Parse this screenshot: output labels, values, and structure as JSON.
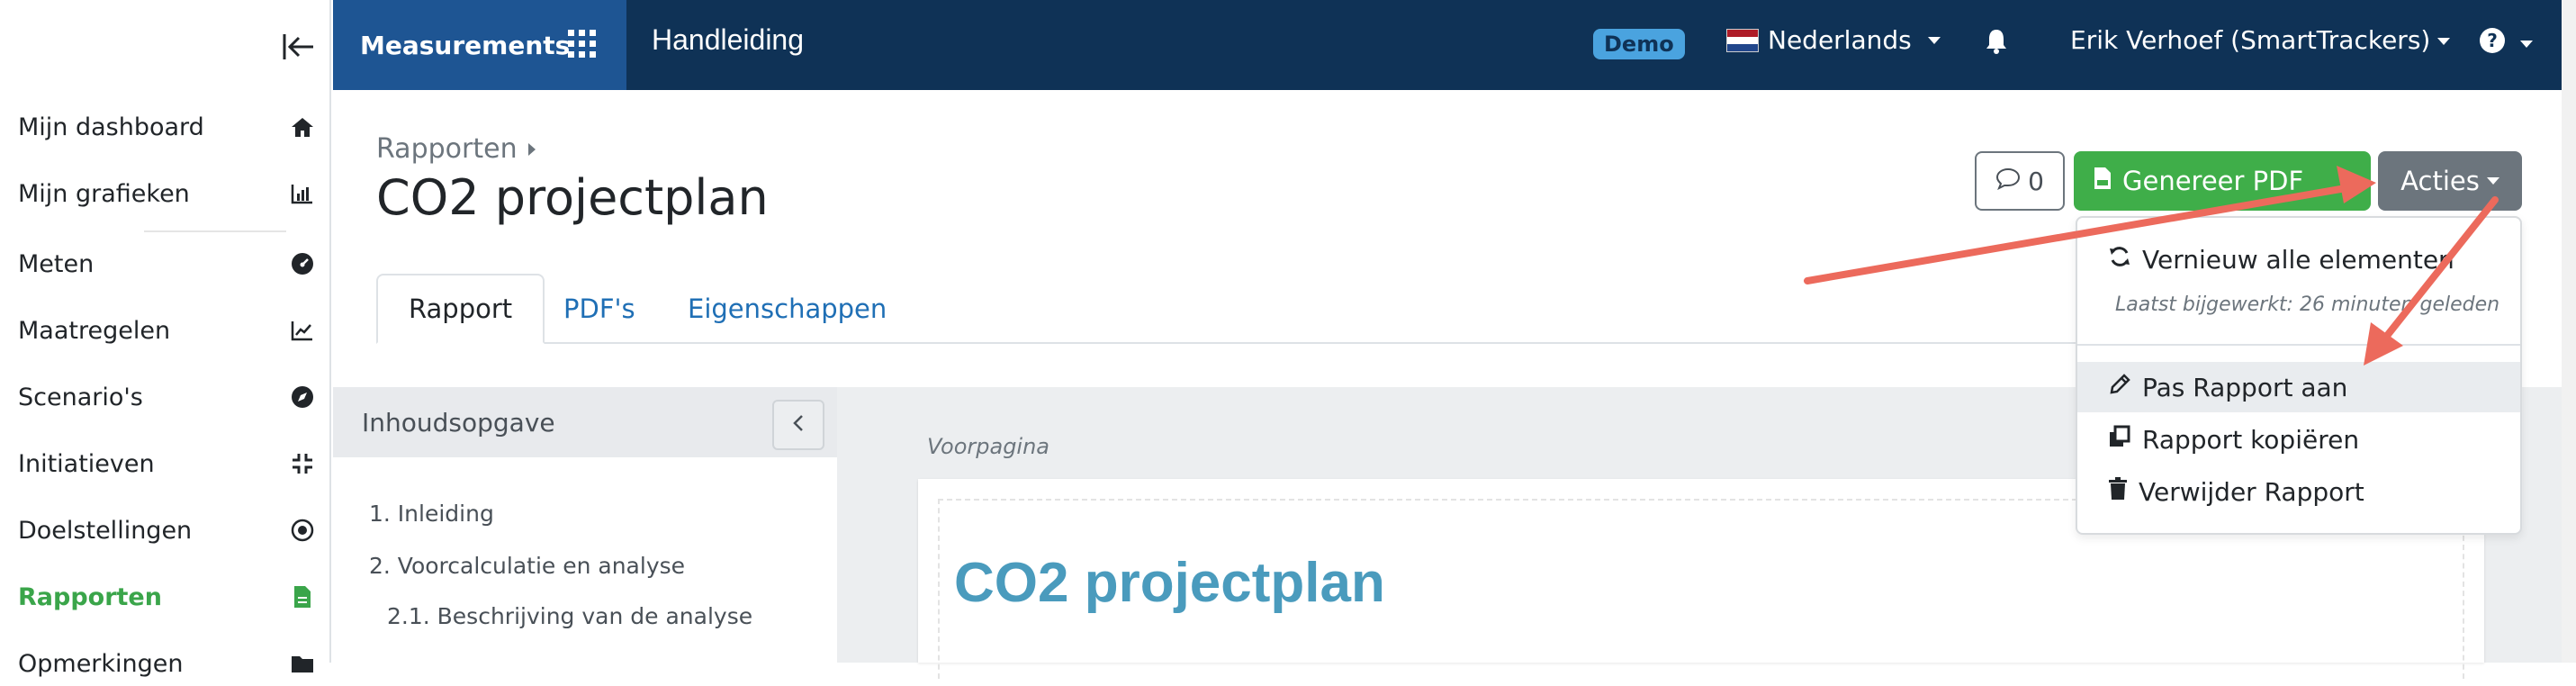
{
  "sidebar": {
    "items": [
      {
        "label": "Mijn dashboard",
        "icon": "home-icon"
      },
      {
        "label": "Mijn grafieken",
        "icon": "bar-chart-icon"
      },
      {
        "label": "Meten",
        "icon": "gauge-icon"
      },
      {
        "label": "Maatregelen",
        "icon": "line-chart-icon"
      },
      {
        "label": "Scenario's",
        "icon": "compass-icon"
      },
      {
        "label": "Initiatieven",
        "icon": "compress-icon"
      },
      {
        "label": "Doelstellingen",
        "icon": "target-icon"
      },
      {
        "label": "Rapporten",
        "icon": "file-icon",
        "active": true
      },
      {
        "label": "Opmerkingen",
        "icon": "folder-icon"
      }
    ]
  },
  "topbar": {
    "brand": "Measurements",
    "handleiding": "Handleiding",
    "demo": "Demo",
    "language": "Nederlands",
    "user": "Erik Verhoef (SmartTrackers)",
    "help": "?"
  },
  "header": {
    "breadcrumb": "Rapporten",
    "title": "CO2 projectplan",
    "comments_count": "0",
    "pdf_button": "Genereer PDF",
    "acties_button": "Acties"
  },
  "tabs": [
    {
      "label": "Rapport",
      "active": true
    },
    {
      "label": "PDF's"
    },
    {
      "label": "Eigenschappen"
    }
  ],
  "dropdown": {
    "refresh": "Vernieuw alle elementen",
    "last_updated": "Laatst bijgewerkt: 26 minuten geleden",
    "edit": "Pas Rapport aan",
    "copy": "Rapport kopiëren",
    "delete": "Verwijder Rapport"
  },
  "toc": {
    "heading": "Inhoudsopgave",
    "items": [
      "1. Inleiding",
      "2. Voorcalculatie en analyse",
      "2.1. Beschrijving van de analyse"
    ]
  },
  "content": {
    "section_label": "Voorpagina",
    "page_title": "CO2 projectplan"
  },
  "colors": {
    "topbar": "#0f3256",
    "brand": "#1e5593",
    "pdf_button": "#3fae49",
    "acties_button": "#6c757d",
    "active_sidebar": "#3aa54a",
    "arrow": "#ec6a5c",
    "page_title": "#4a9bbd"
  }
}
